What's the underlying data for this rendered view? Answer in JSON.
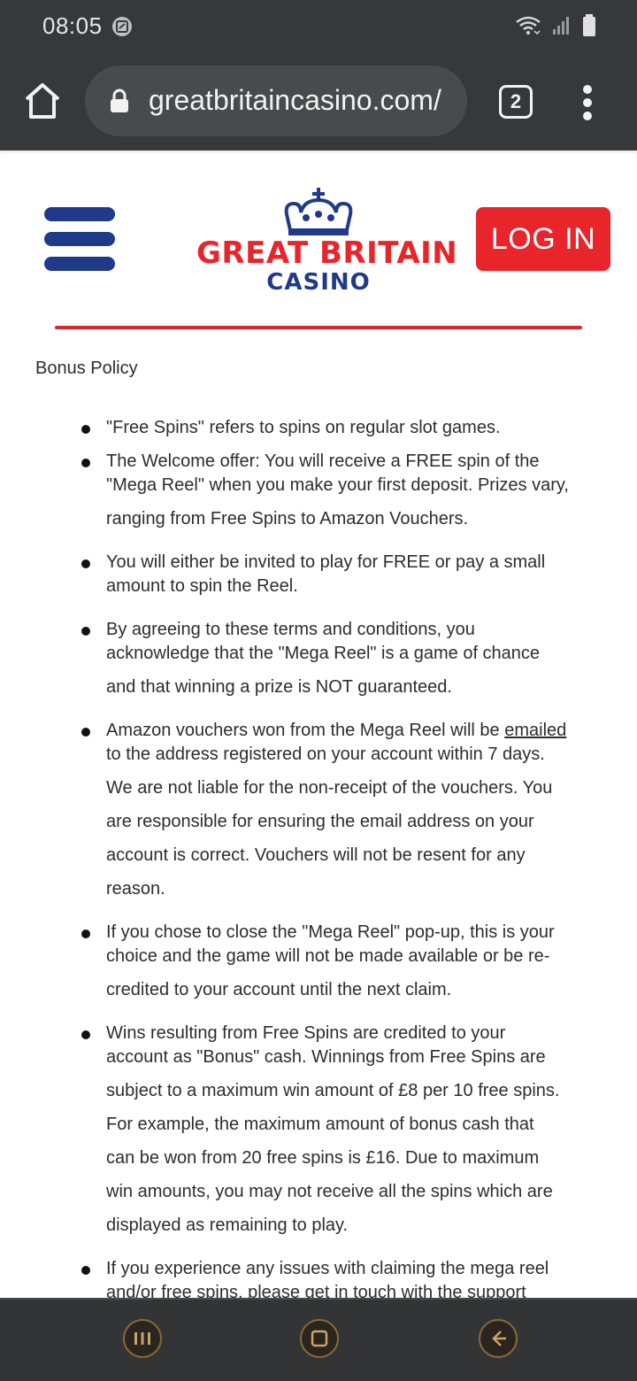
{
  "status_bar": {
    "time": "08:05",
    "icons": [
      "screenshot-icon",
      "wifi-icon",
      "signal-icon",
      "battery-icon"
    ]
  },
  "browser": {
    "url": "greatbritaincasino.com/",
    "tab_count": "2",
    "icons": [
      "home-icon",
      "lock-icon",
      "more-vert-icon"
    ]
  },
  "site_header": {
    "logo_line1": "GREAT BRITAIN",
    "logo_line2": "CASINO",
    "login_label": "LOG IN",
    "colors": {
      "brand_red": "#e9252c",
      "brand_navy": "#1f3a8a"
    }
  },
  "content": {
    "title": "Bonus Policy",
    "bullets": [
      {
        "lines": [
          "\"Free Spins\" refers to spins on regular slot games."
        ]
      },
      {
        "lines": [
          "The Welcome offer: You will receive a FREE spin of the",
          "\"Mega Reel\" when you make your first deposit. Prizes vary,",
          "ranging from Free Spins to Amazon Vouchers."
        ]
      },
      {
        "lines": [
          "You will either be invited to play for FREE or pay a small",
          "amount to spin the Reel."
        ]
      },
      {
        "lines": [
          "By agreeing to these terms and conditions, you",
          "acknowledge that the \"Mega Reel\" is a game of chance",
          "and that winning a prize is NOT guaranteed."
        ]
      },
      {
        "line1_before_link": "Amazon vouchers won from the Mega Reel will be ",
        "link_text": "emailed",
        "lines_after": [
          "to the address registered on your account within 7 days.",
          "We are not liable for the non-receipt of the vouchers. You",
          "are responsible for ensuring the email address on your",
          "account is correct. Vouchers will not be resent for any",
          "reason."
        ]
      },
      {
        "lines": [
          "If you chose to close the \"Mega Reel\" pop-up, this is your",
          "choice and the game will not be made available or be re-",
          "credited to your account until the next claim."
        ]
      },
      {
        "lines": [
          "Wins resulting from Free Spins are credited to your",
          "account as \"Bonus\" cash. Winnings from Free Spins are",
          "subject to a maximum win amount of £8 per 10 free spins.",
          "For example, the maximum amount of bonus cash that",
          "can be won from 20 free spins is £16. Due to maximum",
          "win amounts, you may not receive all the spins which are",
          "displayed as remaining to play."
        ]
      },
      {
        "lines": [
          "If you experience any issues with claiming the mega reel",
          "and/or free spins, please get in touch with the support"
        ]
      }
    ]
  },
  "nav_bar": {
    "buttons": [
      "recents-icon",
      "home-nav-icon",
      "back-icon"
    ]
  }
}
